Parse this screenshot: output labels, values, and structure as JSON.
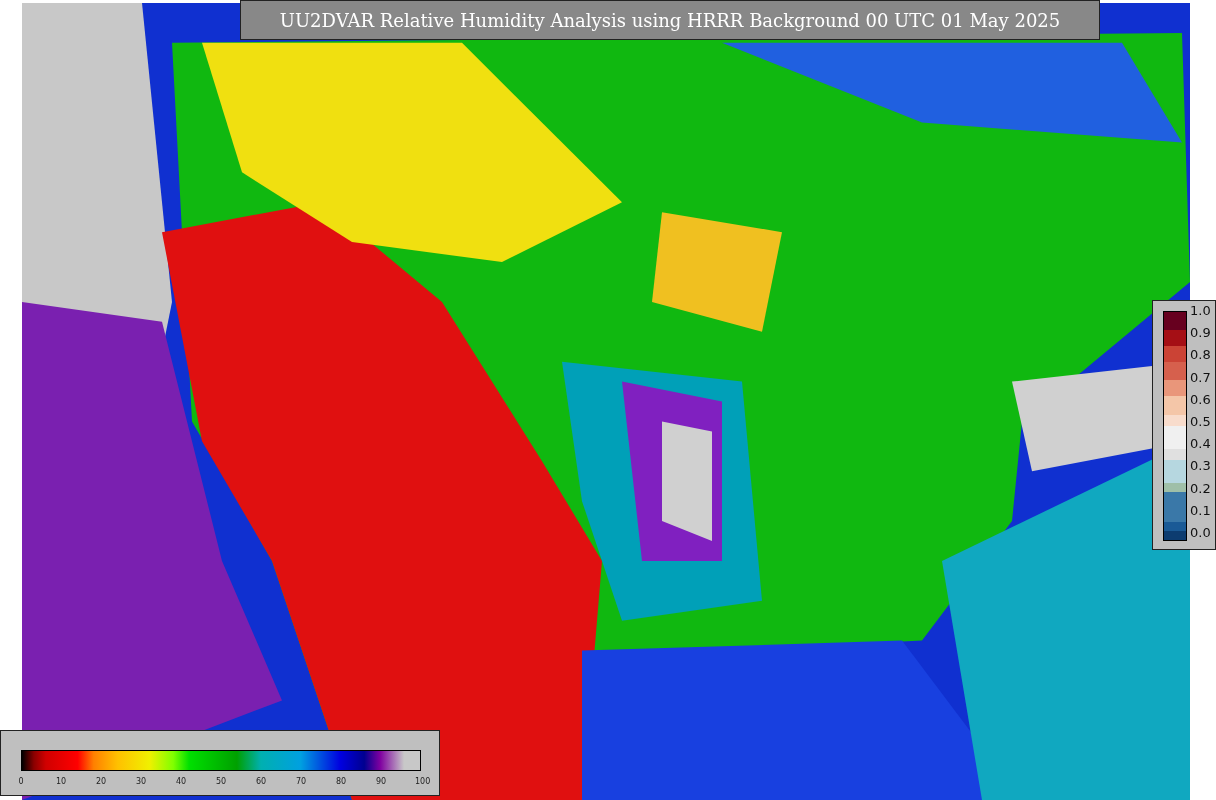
{
  "title": "UU2DVAR Relative Humidity Analysis using HRRR Background 00 UTC 01 May 2025",
  "humidity_colorbar": {
    "ticks": [
      "0",
      "10",
      "20",
      "30",
      "40",
      "50",
      "60",
      "70",
      "80",
      "90",
      "100"
    ]
  },
  "observation_colorbar": {
    "ticks": [
      "1.0",
      "0.9",
      "0.8",
      "0.7",
      "0.6",
      "0.5",
      "0.4",
      "0.3",
      "0.2",
      "0.1",
      "0.0"
    ]
  }
}
